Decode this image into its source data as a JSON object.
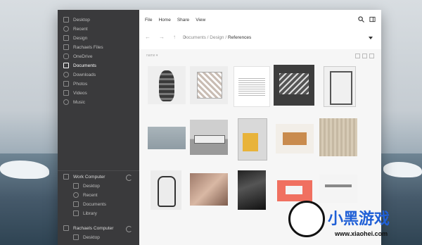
{
  "sidebar": {
    "items": [
      {
        "label": "Desktop",
        "active": false
      },
      {
        "label": "Recent",
        "active": false
      },
      {
        "label": "Design",
        "active": false
      },
      {
        "label": "Rachaels Files",
        "active": false
      },
      {
        "label": "OneDrive",
        "active": false
      },
      {
        "label": "Documents",
        "active": true
      },
      {
        "label": "Downloads",
        "active": false
      },
      {
        "label": "Photos",
        "active": false
      },
      {
        "label": "Videos",
        "active": false
      },
      {
        "label": "Music",
        "active": false
      }
    ],
    "computers": [
      {
        "label": "Work Computer",
        "children": [
          "Desktop",
          "Recent",
          "Documents",
          "Library"
        ]
      },
      {
        "label": "Rachaels Computer",
        "children": [
          "Desktop"
        ]
      }
    ]
  },
  "menu": [
    "File",
    "Home",
    "Share",
    "View"
  ],
  "breadcrumb": {
    "parts": [
      "Documents",
      "Design"
    ],
    "current": "References",
    "separator": " / "
  },
  "sort_label": "name ▾",
  "watermark": {
    "text": "小黑游戏",
    "url": "www.xiaohei.com"
  }
}
